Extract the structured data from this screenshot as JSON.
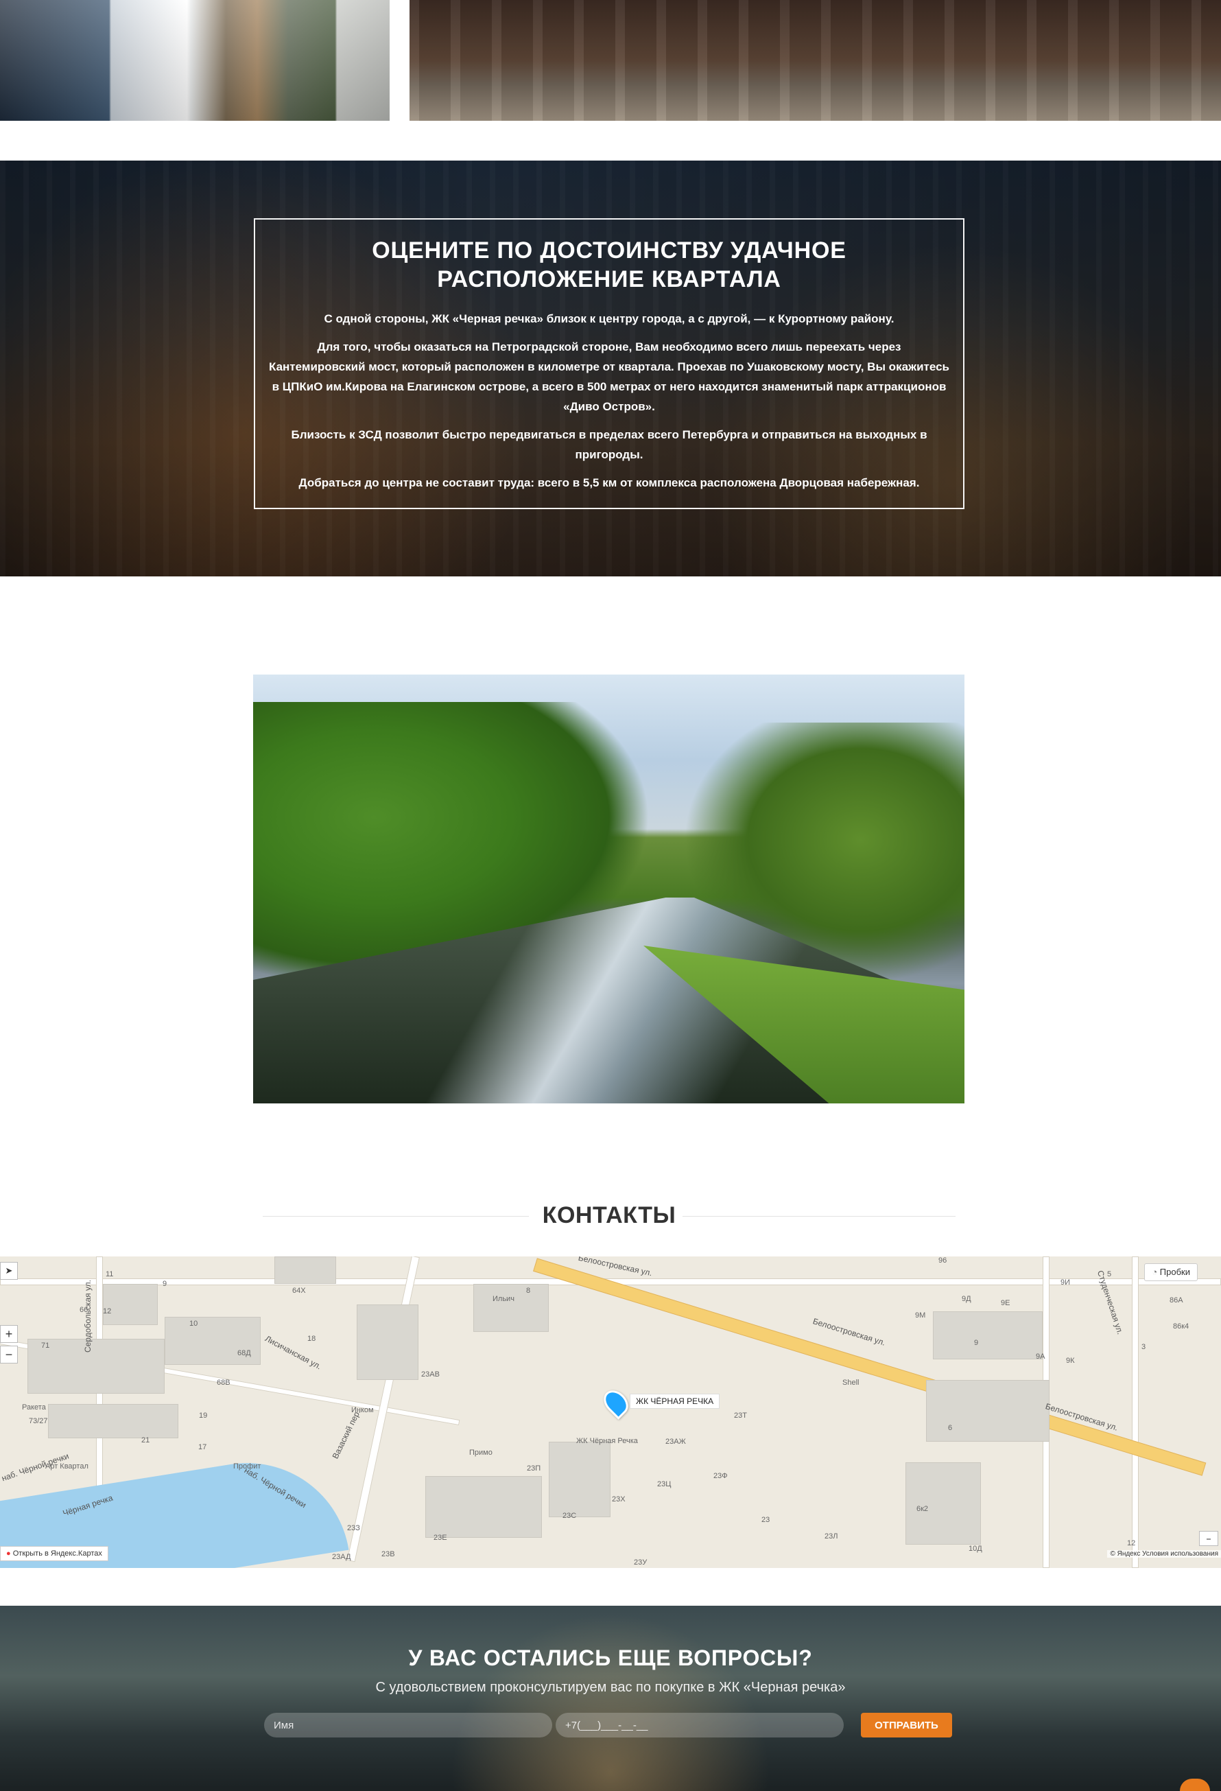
{
  "location": {
    "title": "ОЦЕНИТЕ ПО ДОСТОИНСТВУ УДАЧНОЕ РАСПОЛОЖЕНИЕ КВАРТАЛА",
    "paragraphs": [
      "С одной стороны, ЖК «Черная речка» близок к центру города, а с другой, — к Курортному району.",
      "Для того, чтобы оказаться на Петроградской стороне, Вам необходимо всего лишь переехать через Кантемировский мост, который расположен в километре от квартала. Проехав по Ушаковскому мосту, Вы окажитесь в ЦПКиО им.Кирова на Елагинском острове, а всего в 500 метрах от него находится знаменитый парк аттракционов «Диво Остров».",
      "Близость к ЗСД позволит быстро передвигаться в пределах всего Петербурга и отправиться на выходных в пригороды.",
      "Добраться до центра не составит труда: всего в 5,5 км от комплекса расположена Дворцовая набережная."
    ]
  },
  "contacts": {
    "title": "КОНТАКТЫ"
  },
  "map": {
    "traffic_label": "Пробки",
    "pin_label": "ЖК ЧЁРНАЯ РЕЧКА",
    "open_label": "Открыть в Яндекс.Картах",
    "copyright": "© Яндекс Условия использования",
    "streets": [
      "Белоостровская ул.",
      "Белоостровская ул.",
      "Белоостровская ул.",
      "наб. Чёрной речки",
      "наб. Чёрной речки",
      "Чёрная речка",
      "Студенческая ул.",
      "Сердобольская ул.",
      "Лисичанская ул.",
      "Вазаский пер."
    ],
    "labels": [
      "Ильич",
      "Инком",
      "Ракета",
      "Арт Квартал",
      "Профит",
      "Примо",
      "Shell",
      "ЖК Чёрная Речка",
      "23Т",
      "23Ф",
      "23АЖ",
      "23П",
      "23С",
      "23Х",
      "23Ц",
      "23Л",
      "23",
      "23АВ",
      "23З",
      "23Е",
      "23В",
      "23АД",
      "23У",
      "8",
      "9",
      "10",
      "11",
      "12",
      "18",
      "21",
      "17",
      "19",
      "64Х",
      "68Д",
      "68В",
      "66",
      "71",
      "73/27",
      "9Д",
      "9Е",
      "9М",
      "9",
      "9А",
      "9К",
      "3",
      "5",
      "6",
      "6к2",
      "10Д",
      "12",
      "86А",
      "86к4",
      "96",
      "9И"
    ]
  },
  "questions": {
    "title": "У ВАС ОСТАЛИСЬ ЕЩЕ ВОПРОСЫ?",
    "subtitle": "С удовольствием проконсультируем вас по покупке в ЖК «Черная речка»",
    "name_placeholder": "Имя",
    "phone_placeholder": "+7(___)___-__-__",
    "button_label": "ОТПРАВИТЬ"
  }
}
